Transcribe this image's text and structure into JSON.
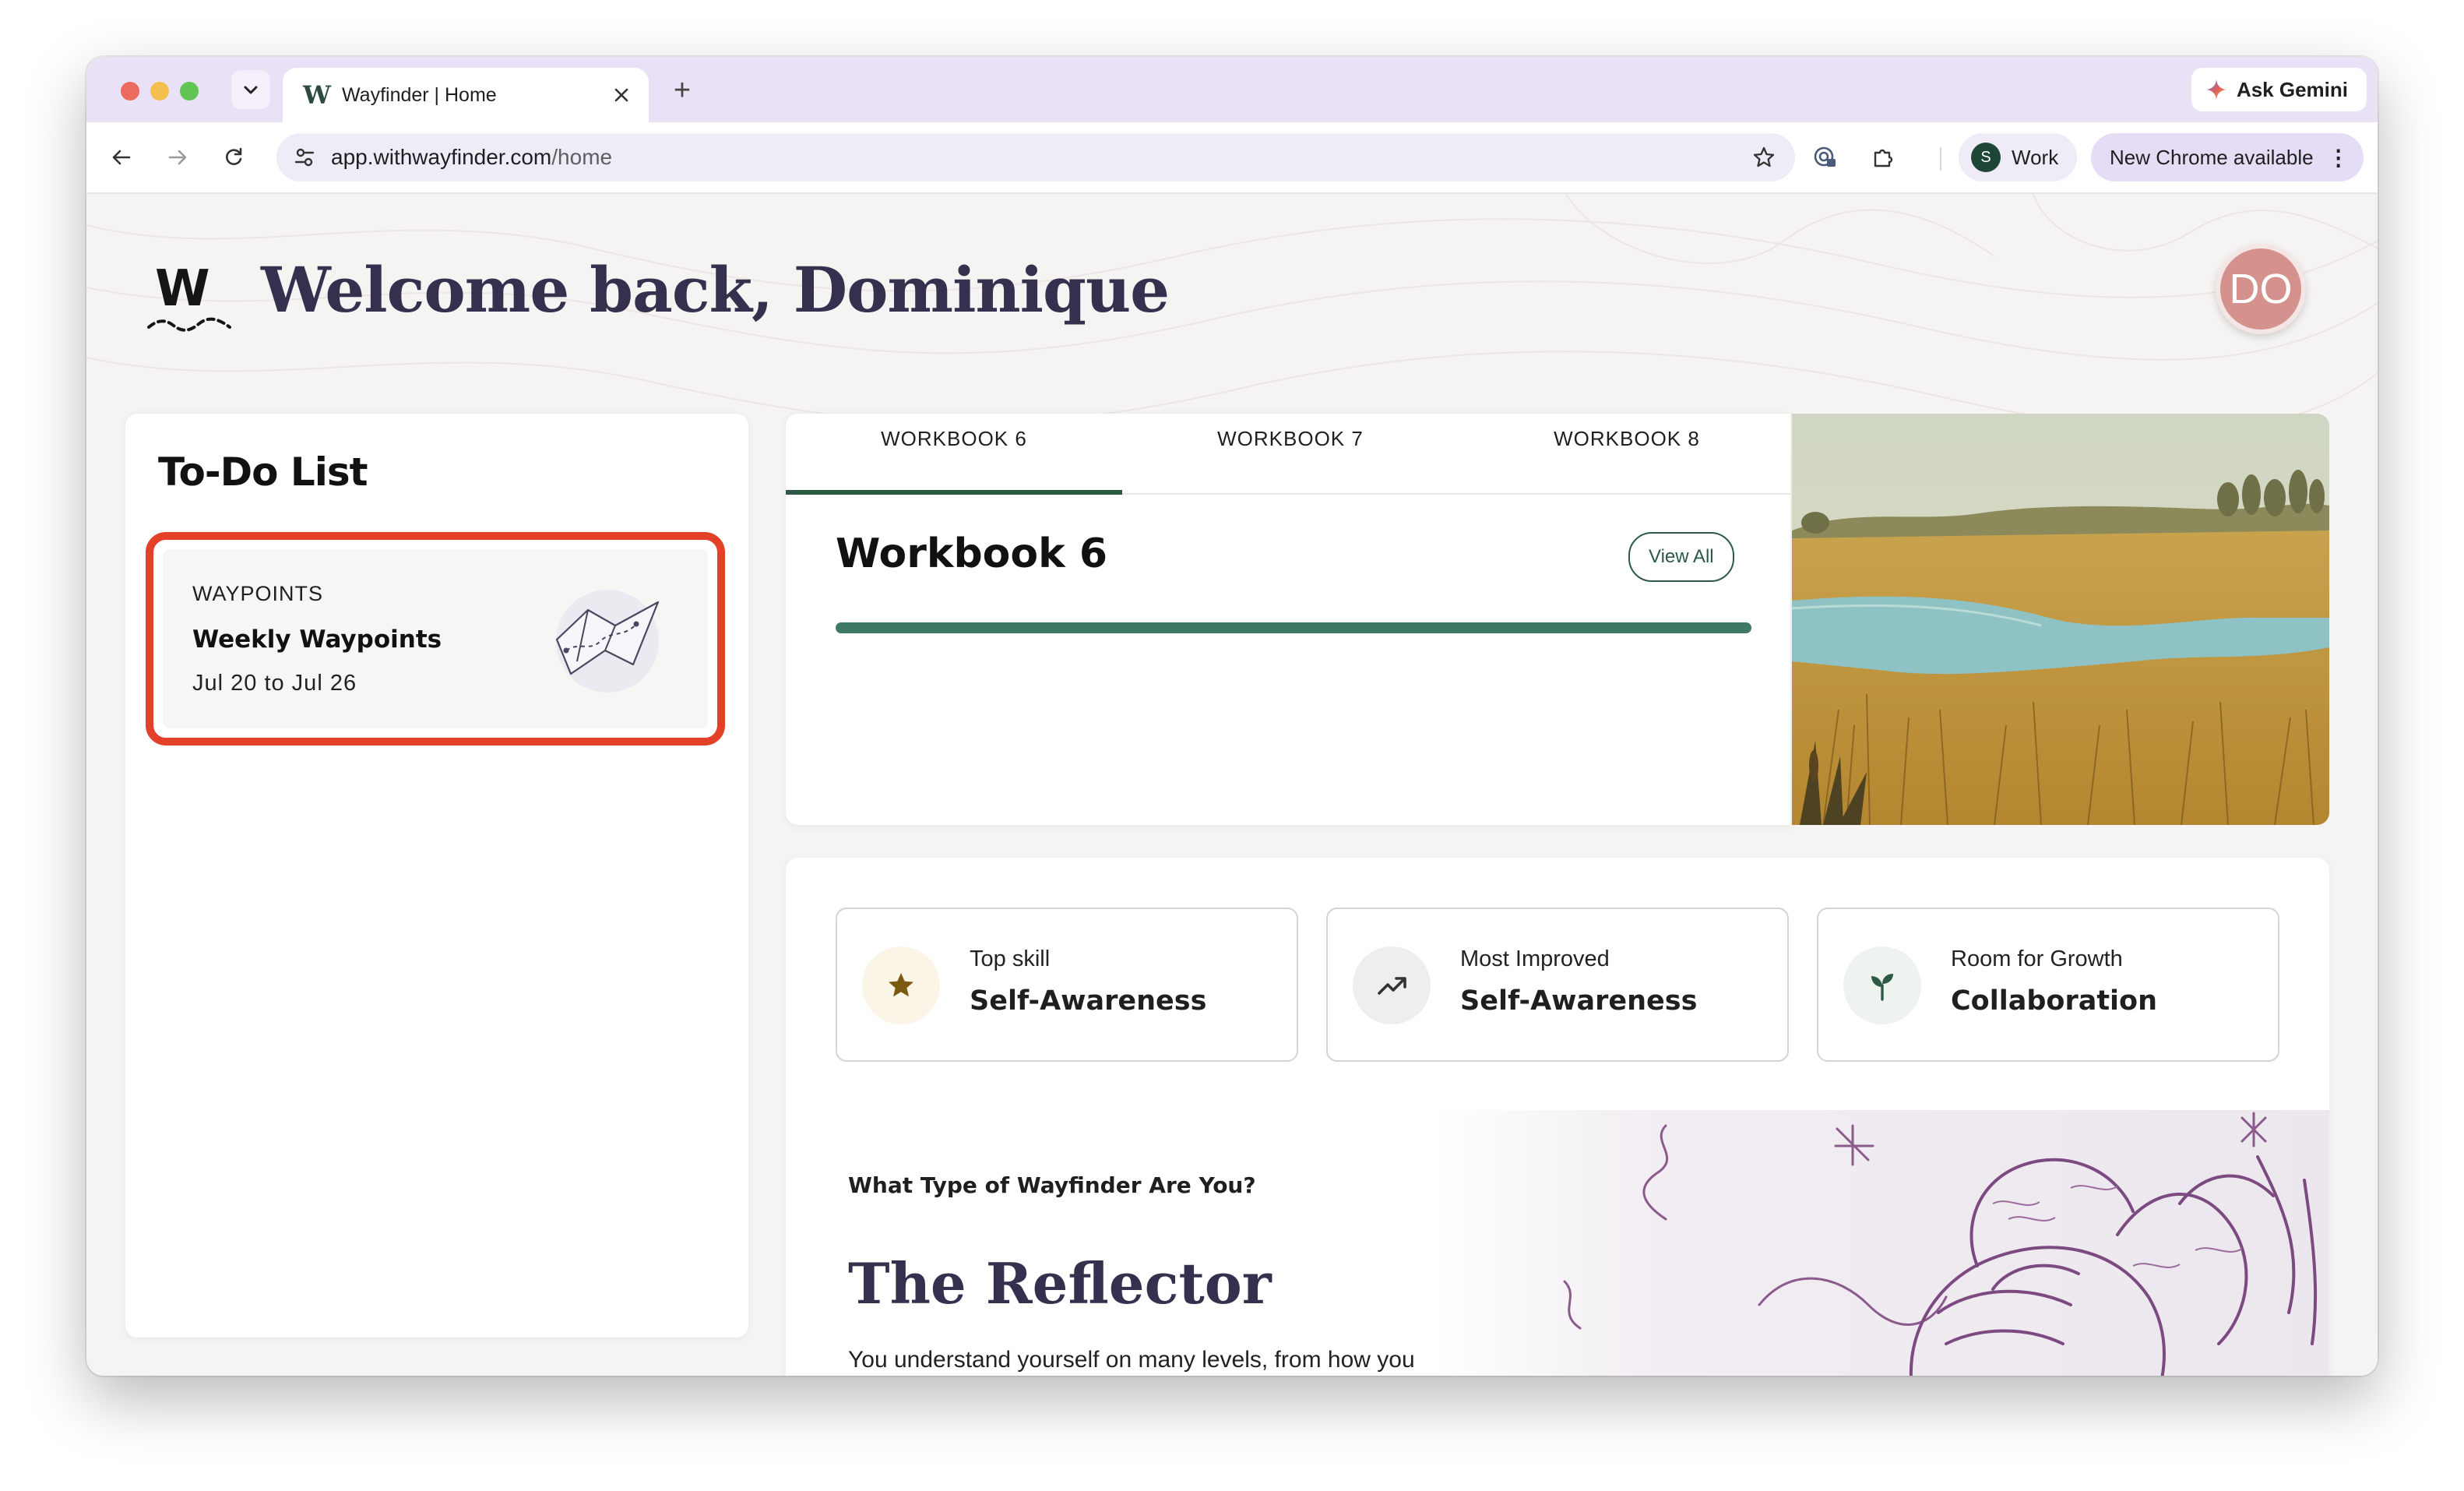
{
  "browser": {
    "tab_title": "Wayfinder | Home",
    "tab_favicon": "W",
    "new_tab": "+",
    "ask_gemini": "Ask Gemini",
    "url_host": "app.withwayfinder.com",
    "url_path": "/home",
    "profile_initial": "S",
    "profile_name": "Work",
    "update_label": "New Chrome available"
  },
  "header": {
    "logo_letter": "W",
    "welcome": "Welcome back, Dominique",
    "avatar_initials": "DO"
  },
  "todo": {
    "title": "To-Do List",
    "items": [
      {
        "kind": "WAYPOINTS",
        "name": "Weekly Waypoints",
        "dates": "Jul 20 to Jul 26"
      }
    ]
  },
  "workbooks": {
    "tabs": [
      "WORKBOOK 6",
      "WORKBOOK 7",
      "WORKBOOK 8"
    ],
    "active_tab": 0,
    "title": "Workbook 6",
    "view_all": "View All",
    "progress": 1.0,
    "accent": "#2d5a45"
  },
  "skills": [
    {
      "label": "Top skill",
      "value": "Self-Awareness",
      "icon": "star-icon",
      "icon_bg": "#fbf5e8",
      "icon_color": "#7a5a12"
    },
    {
      "label": "Most Improved",
      "value": "Self-Awareness",
      "icon": "trending-up-icon",
      "icon_bg": "#eeeeee",
      "icon_color": "#333333"
    },
    {
      "label": "Room for Growth",
      "value": "Collaboration",
      "icon": "sprout-icon",
      "icon_bg": "#eef3f0",
      "icon_color": "#2d5a45"
    }
  ],
  "wayfinder_type": {
    "question": "What Type of Wayfinder Are You?",
    "type": "The Reflector",
    "description": "You understand yourself on many levels, from how you"
  },
  "colors": {
    "highlight": "#e34029",
    "title_text": "#36304f",
    "avatar_bg": "#d4918d"
  }
}
